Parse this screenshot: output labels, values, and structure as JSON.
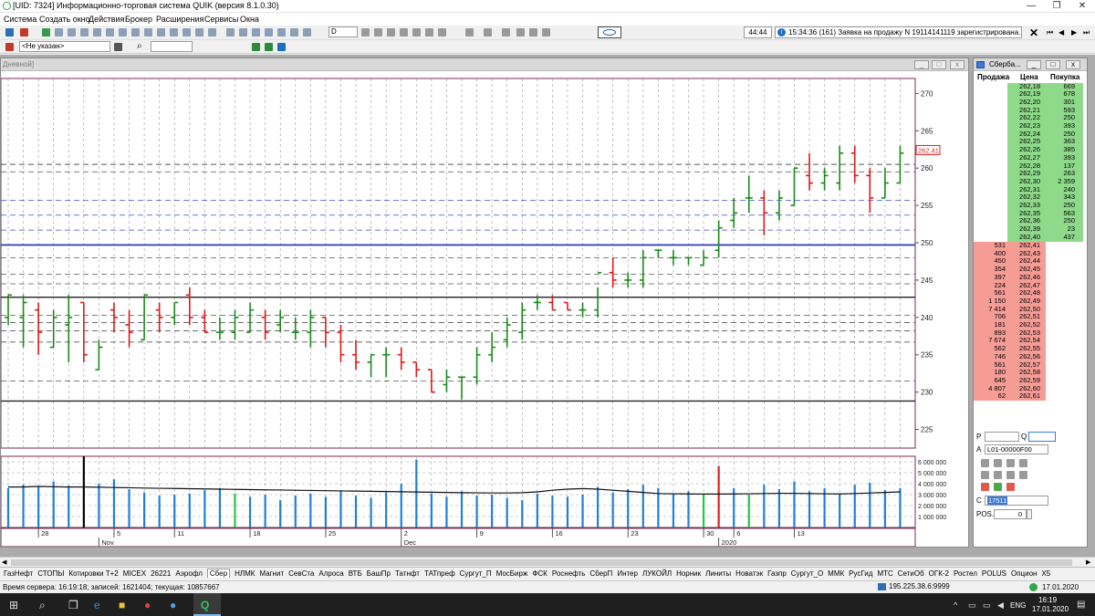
{
  "app": {
    "title": "[UID: 7324] Информационно-торговая система QUIK (версия 8.1.0.30)",
    "minimize": "—",
    "maximize": "❐",
    "close": "✕"
  },
  "menu": [
    "Система",
    "Создать окно",
    "Действия",
    "Брокер",
    "Расширения",
    "Сервисы",
    "Окна"
  ],
  "toolbar": {
    "interval": "D",
    "time": "44:44",
    "message": "15:34:36 (161) Заявка на продажу N 19114141119 зарегистрирована."
  },
  "toolbar2": {
    "account": "<Не указан>"
  },
  "chart_window": {
    "caption": "Дневной]",
    "price_label": "262.41"
  },
  "chart_data": {
    "type": "ohlc",
    "price_axis": {
      "ticks": [
        225,
        230,
        235,
        240,
        245,
        250,
        255,
        260,
        265,
        270
      ],
      "ylim": [
        222.5,
        272
      ]
    },
    "last_price": 262.41,
    "date_labels": [
      {
        "i": 2,
        "text": "28"
      },
      {
        "i": 7,
        "text": "5"
      },
      {
        "i": 11,
        "text": "11"
      },
      {
        "i": 16,
        "text": "18"
      },
      {
        "i": 21,
        "text": "25"
      },
      {
        "i": 26,
        "text": "2"
      },
      {
        "i": 31,
        "text": "9"
      },
      {
        "i": 36,
        "text": "16"
      },
      {
        "i": 41,
        "text": "23"
      },
      {
        "i": 46,
        "text": "30"
      },
      {
        "i": 48,
        "text": "6"
      },
      {
        "i": 52,
        "text": "13"
      }
    ],
    "month_labels": [
      {
        "i": 6,
        "text": "Nov"
      },
      {
        "i": 26,
        "text": "Dec"
      },
      {
        "i": 47,
        "text": "2020"
      }
    ],
    "bars": [
      {
        "o": 240,
        "h": 243,
        "l": 239,
        "c": 243
      },
      {
        "o": 240,
        "h": 243,
        "l": 236,
        "c": 242
      },
      {
        "o": 241,
        "h": 242,
        "l": 235,
        "c": 238
      },
      {
        "o": 236,
        "h": 241,
        "l": 236,
        "c": 240
      },
      {
        "o": 239,
        "h": 243,
        "l": 234,
        "c": 240
      },
      {
        "o": 242,
        "h": 242,
        "l": 234,
        "c": 235
      },
      {
        "o": 233,
        "h": 237,
        "l": 233,
        "c": 236
      },
      {
        "o": 241,
        "h": 242,
        "l": 238,
        "c": 240
      },
      {
        "o": 239,
        "h": 241,
        "l": 236,
        "c": 238
      },
      {
        "o": 237,
        "h": 243,
        "l": 237,
        "c": 243
      },
      {
        "o": 241,
        "h": 242,
        "l": 238,
        "c": 240
      },
      {
        "o": 240,
        "h": 242,
        "l": 239,
        "c": 242
      },
      {
        "o": 243,
        "h": 244,
        "l": 239,
        "c": 240
      },
      {
        "o": 240,
        "h": 241,
        "l": 238,
        "c": 238
      },
      {
        "o": 238,
        "h": 240,
        "l": 237,
        "c": 238
      },
      {
        "o": 238,
        "h": 241,
        "l": 237,
        "c": 240
      },
      {
        "o": 238,
        "h": 242,
        "l": 238,
        "c": 241
      },
      {
        "o": 240,
        "h": 241,
        "l": 237,
        "c": 238
      },
      {
        "o": 239,
        "h": 241,
        "l": 238,
        "c": 240
      },
      {
        "o": 238,
        "h": 240,
        "l": 237,
        "c": 238
      },
      {
        "o": 238,
        "h": 241,
        "l": 236,
        "c": 240
      },
      {
        "o": 240,
        "h": 240,
        "l": 236,
        "c": 238
      },
      {
        "o": 238,
        "h": 239,
        "l": 234,
        "c": 235
      },
      {
        "o": 235,
        "h": 237,
        "l": 233,
        "c": 234
      },
      {
        "o": 234,
        "h": 235,
        "l": 232,
        "c": 235
      },
      {
        "o": 235,
        "h": 236,
        "l": 232,
        "c": 235
      },
      {
        "o": 235,
        "h": 236,
        "l": 233,
        "c": 234
      },
      {
        "o": 234,
        "h": 234,
        "l": 232,
        "c": 233
      },
      {
        "o": 233,
        "h": 233,
        "l": 230,
        "c": 230
      },
      {
        "o": 231,
        "h": 233,
        "l": 230,
        "c": 232
      },
      {
        "o": 232,
        "h": 232,
        "l": 229,
        "c": 232
      },
      {
        "o": 232,
        "h": 236,
        "l": 231,
        "c": 235
      },
      {
        "o": 235,
        "h": 238,
        "l": 234,
        "c": 236
      },
      {
        "o": 237,
        "h": 240,
        "l": 236,
        "c": 239
      },
      {
        "o": 238,
        "h": 242,
        "l": 237,
        "c": 241
      },
      {
        "o": 242,
        "h": 243,
        "l": 241,
        "c": 242
      },
      {
        "o": 242,
        "h": 243,
        "l": 241,
        "c": 241
      },
      {
        "o": 242,
        "h": 242,
        "l": 241,
        "c": 241
      },
      {
        "o": 241,
        "h": 242,
        "l": 240,
        "c": 241
      },
      {
        "o": 241,
        "h": 244,
        "l": 240,
        "c": 246
      },
      {
        "o": 246,
        "h": 248,
        "l": 244,
        "c": 245
      },
      {
        "o": 245,
        "h": 246,
        "l": 244,
        "c": 245
      },
      {
        "o": 245,
        "h": 249,
        "l": 244,
        "c": 248
      },
      {
        "o": 249,
        "h": 249,
        "l": 248,
        "c": 249
      },
      {
        "o": 248,
        "h": 249,
        "l": 247,
        "c": 248
      },
      {
        "o": 248,
        "h": 248,
        "l": 247,
        "c": 248
      },
      {
        "o": 247,
        "h": 249,
        "l": 247,
        "c": 248
      },
      {
        "o": 249,
        "h": 253,
        "l": 248,
        "c": 252
      },
      {
        "o": 253,
        "h": 256,
        "l": 252,
        "c": 254
      },
      {
        "o": 256,
        "h": 259,
        "l": 254,
        "c": 256
      },
      {
        "o": 256,
        "h": 257,
        "l": 251,
        "c": 254
      },
      {
        "o": 254,
        "h": 257,
        "l": 253,
        "c": 256
      },
      {
        "o": 255,
        "h": 260,
        "l": 255,
        "c": 260
      },
      {
        "o": 259,
        "h": 262,
        "l": 257,
        "c": 258
      },
      {
        "o": 258,
        "h": 260,
        "l": 257,
        "c": 259
      },
      {
        "o": 258,
        "h": 263,
        "l": 257,
        "c": 262
      },
      {
        "o": 262,
        "h": 263,
        "l": 258,
        "c": 259
      },
      {
        "o": 259,
        "h": 260,
        "l": 254,
        "c": 256
      },
      {
        "o": 256,
        "h": 260,
        "l": 256,
        "c": 258
      },
      {
        "o": 258,
        "h": 263,
        "l": 258,
        "c": 262
      }
    ],
    "volume_axis": {
      "ticks": [
        1000000,
        2000000,
        3000000,
        4000000,
        5000000,
        6000000
      ],
      "labels": [
        "1 000 000",
        "2 000 000",
        "3 000 000",
        "4 000 000",
        "5 000 000",
        "6 000 000"
      ],
      "ylim": [
        0,
        6500000
      ]
    },
    "volume": [
      {
        "v": 3600000,
        "col": "#1f7fd9"
      },
      {
        "v": 3900000,
        "col": "#1f7fd9"
      },
      {
        "v": 3700000,
        "col": "#1f7fd9"
      },
      {
        "v": 4200000,
        "col": "#1f7fd9"
      },
      {
        "v": 3800000,
        "col": "#1f7fd9"
      },
      {
        "v": 6500000,
        "col": "#000000"
      },
      {
        "v": 4000000,
        "col": "#1f7fd9"
      },
      {
        "v": 4400000,
        "col": "#1f7fd9"
      },
      {
        "v": 3500000,
        "col": "#1f7fd9"
      },
      {
        "v": 3200000,
        "col": "#1f7fd9"
      },
      {
        "v": 2900000,
        "col": "#1f7fd9"
      },
      {
        "v": 3000000,
        "col": "#1f7fd9"
      },
      {
        "v": 3100000,
        "col": "#1f7fd9"
      },
      {
        "v": 3400000,
        "col": "#1f7fd9"
      },
      {
        "v": 3600000,
        "col": "#1f7fd9"
      },
      {
        "v": 3100000,
        "col": "#22c54a"
      },
      {
        "v": 2800000,
        "col": "#1f7fd9"
      },
      {
        "v": 3000000,
        "col": "#1f7fd9"
      },
      {
        "v": 2500000,
        "col": "#1f7fd9"
      },
      {
        "v": 2900000,
        "col": "#1f7fd9"
      },
      {
        "v": 3100000,
        "col": "#1f7fd9"
      },
      {
        "v": 2800000,
        "col": "#1f7fd9"
      },
      {
        "v": 3300000,
        "col": "#1f7fd9"
      },
      {
        "v": 2900000,
        "col": "#1f7fd9"
      },
      {
        "v": 2700000,
        "col": "#1f7fd9"
      },
      {
        "v": 3200000,
        "col": "#1f7fd9"
      },
      {
        "v": 4000000,
        "col": "#1f7fd9"
      },
      {
        "v": 6200000,
        "col": "#1f7fd9"
      },
      {
        "v": 3100000,
        "col": "#1f7fd9"
      },
      {
        "v": 2800000,
        "col": "#1f7fd9"
      },
      {
        "v": 3300000,
        "col": "#1f7fd9"
      },
      {
        "v": 2900000,
        "col": "#1f7fd9"
      },
      {
        "v": 3000000,
        "col": "#1f7fd9"
      },
      {
        "v": 2700000,
        "col": "#1f7fd9"
      },
      {
        "v": 2500000,
        "col": "#1f7fd9"
      },
      {
        "v": 3100000,
        "col": "#1f7fd9"
      },
      {
        "v": 2900000,
        "col": "#1f7fd9"
      },
      {
        "v": 2800000,
        "col": "#1f7fd9"
      },
      {
        "v": 3000000,
        "col": "#1f7fd9"
      },
      {
        "v": 3700000,
        "col": "#1f7fd9"
      },
      {
        "v": 3200000,
        "col": "#1f7fd9"
      },
      {
        "v": 3500000,
        "col": "#1f7fd9"
      },
      {
        "v": 3900000,
        "col": "#1f7fd9"
      },
      {
        "v": 3600000,
        "col": "#1f7fd9"
      },
      {
        "v": 3100000,
        "col": "#1f7fd9"
      },
      {
        "v": 3300000,
        "col": "#1f7fd9"
      },
      {
        "v": 3000000,
        "col": "#22c54a"
      },
      {
        "v": 5600000,
        "col": "#e02020"
      },
      {
        "v": 3600000,
        "col": "#1f7fd9"
      },
      {
        "v": 3000000,
        "col": "#22c54a"
      },
      {
        "v": 3900000,
        "col": "#1f7fd9"
      },
      {
        "v": 3500000,
        "col": "#1f7fd9"
      },
      {
        "v": 4200000,
        "col": "#1f7fd9"
      },
      {
        "v": 3300000,
        "col": "#1f7fd9"
      },
      {
        "v": 3600000,
        "col": "#1f7fd9"
      },
      {
        "v": 3100000,
        "col": "#1f7fd9"
      },
      {
        "v": 3900000,
        "col": "#1f7fd9"
      },
      {
        "v": 4100000,
        "col": "#1f7fd9"
      },
      {
        "v": 3400000,
        "col": "#1f7fd9"
      },
      {
        "v": 3600000,
        "col": "#1f7fd9"
      }
    ],
    "volume_ma": [
      3700000,
      3700000,
      3750000,
      3720000,
      3700000,
      3700000,
      3680000,
      3650000,
      3630000,
      3600000,
      3580000,
      3560000,
      3540000,
      3520000,
      3500000,
      3480000,
      3460000,
      3440000,
      3420000,
      3400000,
      3380000,
      3360000,
      3340000,
      3320000,
      3300000,
      3280000,
      3260000,
      3240000,
      3220000,
      3200000,
      3180000,
      3160000,
      3150000,
      3150000,
      3180000,
      3250000,
      3400000,
      3500000,
      3550000,
      3500000,
      3400000,
      3300000,
      3200000,
      3100000,
      3080000,
      3060000,
      3050000,
      3050000,
      3060000,
      3080000,
      3100000,
      3120000,
      3120000,
      3100000,
      3080000,
      3060000,
      3100000,
      3150000,
      3200000,
      3250000
    ]
  },
  "orderbook": {
    "caption": "Сберба...",
    "headers": {
      "sell": "Продажа",
      "price": "Цена",
      "buy": "Покупка"
    },
    "buy_rows": [
      {
        "price": "262,18",
        "qty": "669"
      },
      {
        "price": "262,19",
        "qty": "678"
      },
      {
        "price": "262,20",
        "qty": "301"
      },
      {
        "price": "262,21",
        "qty": "593"
      },
      {
        "price": "262,22",
        "qty": "250"
      },
      {
        "price": "262,23",
        "qty": "393"
      },
      {
        "price": "262,24",
        "qty": "250"
      },
      {
        "price": "262,25",
        "qty": "363"
      },
      {
        "price": "262,26",
        "qty": "385"
      },
      {
        "price": "262,27",
        "qty": "393"
      },
      {
        "price": "262,28",
        "qty": "137"
      },
      {
        "price": "262,29",
        "qty": "263"
      },
      {
        "price": "262,30",
        "qty": "2 359"
      },
      {
        "price": "262,31",
        "qty": "240"
      },
      {
        "price": "262,32",
        "qty": "343"
      },
      {
        "price": "262,33",
        "qty": "250"
      },
      {
        "price": "262,35",
        "qty": "563"
      },
      {
        "price": "262,36",
        "qty": "250"
      },
      {
        "price": "262,39",
        "qty": "23"
      },
      {
        "price": "262,40",
        "qty": "437"
      }
    ],
    "sell_rows": [
      {
        "qty": "531",
        "price": "262,41"
      },
      {
        "qty": "400",
        "price": "262,43"
      },
      {
        "qty": "450",
        "price": "262,44"
      },
      {
        "qty": "354",
        "price": "262,45"
      },
      {
        "qty": "397",
        "price": "262,46"
      },
      {
        "qty": "224",
        "price": "262,47"
      },
      {
        "qty": "561",
        "price": "262,48"
      },
      {
        "qty": "1 150",
        "price": "262,49"
      },
      {
        "qty": "7 414",
        "price": "262,50"
      },
      {
        "qty": "706",
        "price": "262,51"
      },
      {
        "qty": "181",
        "price": "262,52"
      },
      {
        "qty": "893",
        "price": "262,53"
      },
      {
        "qty": "7 674",
        "price": "262,54"
      },
      {
        "qty": "562",
        "price": "262,55"
      },
      {
        "qty": "746",
        "price": "262,56"
      },
      {
        "qty": "561",
        "price": "262,57"
      },
      {
        "qty": "180",
        "price": "262,58"
      },
      {
        "qty": "645",
        "price": "262,59"
      },
      {
        "qty": "4 807",
        "price": "262,60"
      },
      {
        "qty": "62",
        "price": "262,61"
      }
    ],
    "form": {
      "p_label": "P",
      "q_label": "Q",
      "a_label": "A",
      "account": "L01-00000F00",
      "c_label": "C",
      "client": "17511",
      "pos_label": "POS.",
      "pos_value": "0"
    }
  },
  "tabs": [
    "ГазНефт",
    "СТОПЫ",
    "Котировки Т+2",
    "MICEX",
    "26221",
    "Аэрофл",
    "Сбер",
    "НЛМК",
    "Магнит",
    "СевСта",
    "Алроса",
    "ВТБ",
    "БашПр",
    "Татнфт",
    "ТАТпреф",
    "Сургут_П",
    "МосБирж",
    "ФСК",
    "Роснефть",
    "СберП",
    "Интер",
    "ЛУКОЙЛ",
    "Норник",
    "Линиты",
    "Новатэк",
    "Газпр",
    "Сургут_О",
    "ММК",
    "РусГид",
    "МТС",
    "СетиОб",
    "ОГК-2",
    "Ростел",
    "POLUS",
    "Опцион",
    "Х5"
  ],
  "active_tab": "Сбер",
  "status": {
    "left": "Время сервера: 16:19:18; записей: 1621404; текущая: 10857667",
    "date": "17.01.2020",
    "server": "195.225.38.6:9999"
  },
  "taskbar": {
    "lang": "ENG",
    "time": "16:19",
    "date": "17.01.2020"
  }
}
